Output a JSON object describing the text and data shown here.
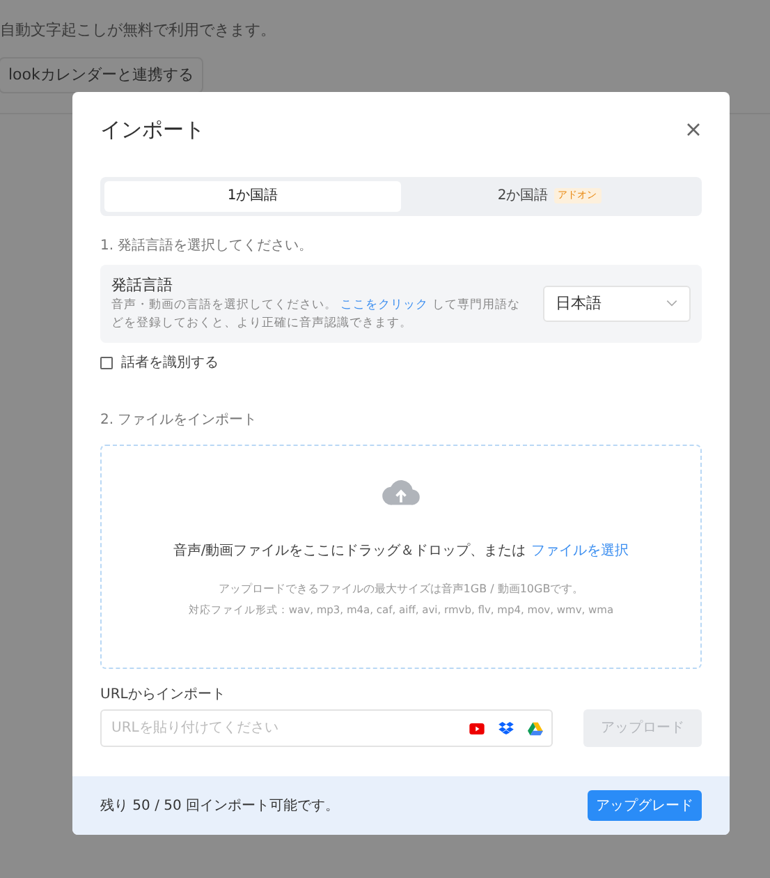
{
  "background": {
    "text": "自動文字起こしが無料で利用できます。",
    "button": "lookカレンダーと連携する"
  },
  "dialog": {
    "title": "インポート",
    "tabs": [
      {
        "label": "1か国語",
        "selected": true
      },
      {
        "label": "2か国語",
        "selected": false,
        "badge": "アドオン"
      }
    ],
    "step1": "1. 発話言語を選択してください。",
    "language": {
      "title": "発話言語",
      "description_before": "音声・動画の言語を選択してください。",
      "link": "ここをクリック",
      "description_after": "して専門用語などを登録しておくと、より正確に音声認識できます。",
      "value": "日本語"
    },
    "speaker_checkbox": {
      "label": "話者を識別する",
      "checked": false
    },
    "step2": "2. ファイルをインポート",
    "dropzone": {
      "text": "音声/動画ファイルをここにドラッグ＆ドロップ、または",
      "link": "ファイルを選択",
      "limit": "アップロードできるファイルの最大サイズは音声1GB / 動画10GBです。",
      "formats": "対応ファイル形式：wav, mp3, m4a, caf, aiff, avi, rmvb, flv, mp4, mov, wmv, wma"
    },
    "url_import": {
      "label": "URLからインポート",
      "placeholder": "URLを貼り付けてください",
      "button": "アップロード",
      "disabled": true
    },
    "footer": {
      "text": "残り 50 / 50 回インポート可能です。",
      "button": "アップグレード"
    }
  }
}
